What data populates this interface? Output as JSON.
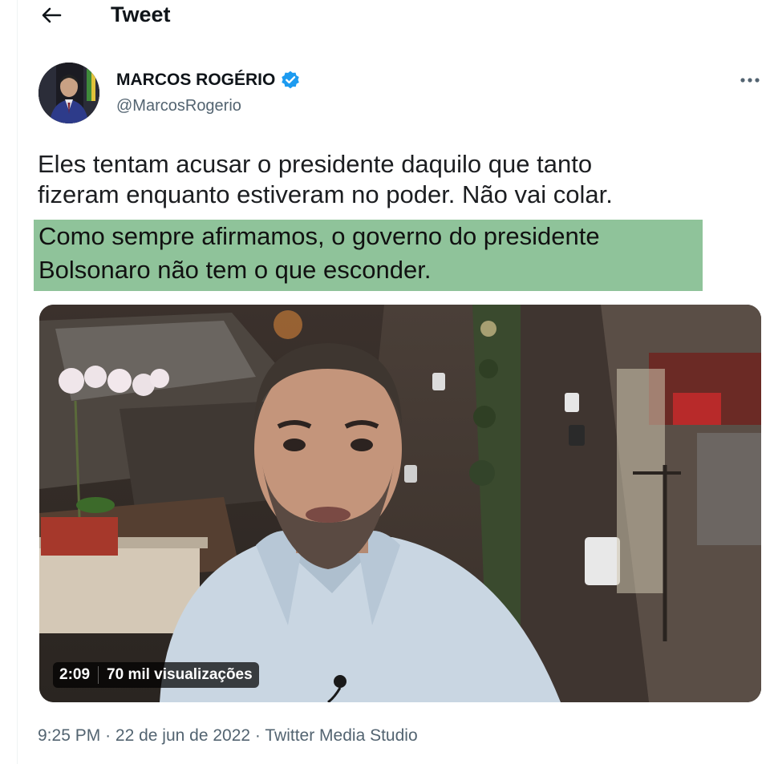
{
  "header": {
    "title": "Tweet",
    "back_icon": "arrow-left-icon"
  },
  "author": {
    "name": "MARCOS ROGÉRIO",
    "handle": "@MarcosRogerio",
    "verified_icon": "verified-badge-icon",
    "verified_color": "#1d9bf0",
    "more_icon": "more-horizontal-icon"
  },
  "tweet": {
    "lines": [
      "Eles tentam acusar o presidente daquilo que tanto",
      "fizeram enquanto estiveram no poder. Não vai colar."
    ],
    "highlighted_lines": [
      "Como sempre afirmamos, o governo do presidente",
      "Bolsonaro não tem o que esconder."
    ],
    "highlight_color": "#8fc39a"
  },
  "media": {
    "type": "video",
    "duration": "2:09",
    "views": "70 mil visualizações"
  },
  "meta": {
    "time": "9:25 PM",
    "separator": "·",
    "date": "22 de jun de 2022",
    "source": "Twitter Media Studio"
  }
}
